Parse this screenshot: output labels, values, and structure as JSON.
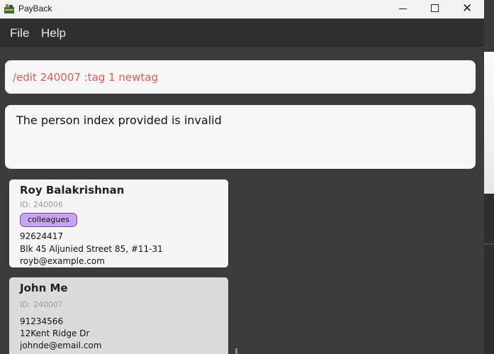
{
  "window": {
    "title": "PayBack",
    "close_glyph": "✕"
  },
  "menu": {
    "items": [
      {
        "label": "File"
      },
      {
        "label": "Help"
      }
    ]
  },
  "command_box": {
    "value": "/edit 240007 :tag 1 newtag"
  },
  "result_display": {
    "message": "The person index provided is invalid"
  },
  "persons": [
    {
      "name": "Roy Balakrishnan",
      "id": "ID: 240006",
      "tags": [
        "colleagues"
      ],
      "phone": "92624417",
      "address": "Blk 45 Aljunied Street 85, #11-31",
      "email": "royb@example.com"
    },
    {
      "name": "John Me",
      "id": "ID: 240007",
      "tags": [],
      "phone": "91234566",
      "address": "12Kent Ridge Dr",
      "email": "johnde@email.com"
    }
  ],
  "colors": {
    "command_text": "#e05a55",
    "tag_background": "#c7a5f3",
    "selected_card": "#dcdcdc",
    "window_background": "#3b3b3b"
  }
}
